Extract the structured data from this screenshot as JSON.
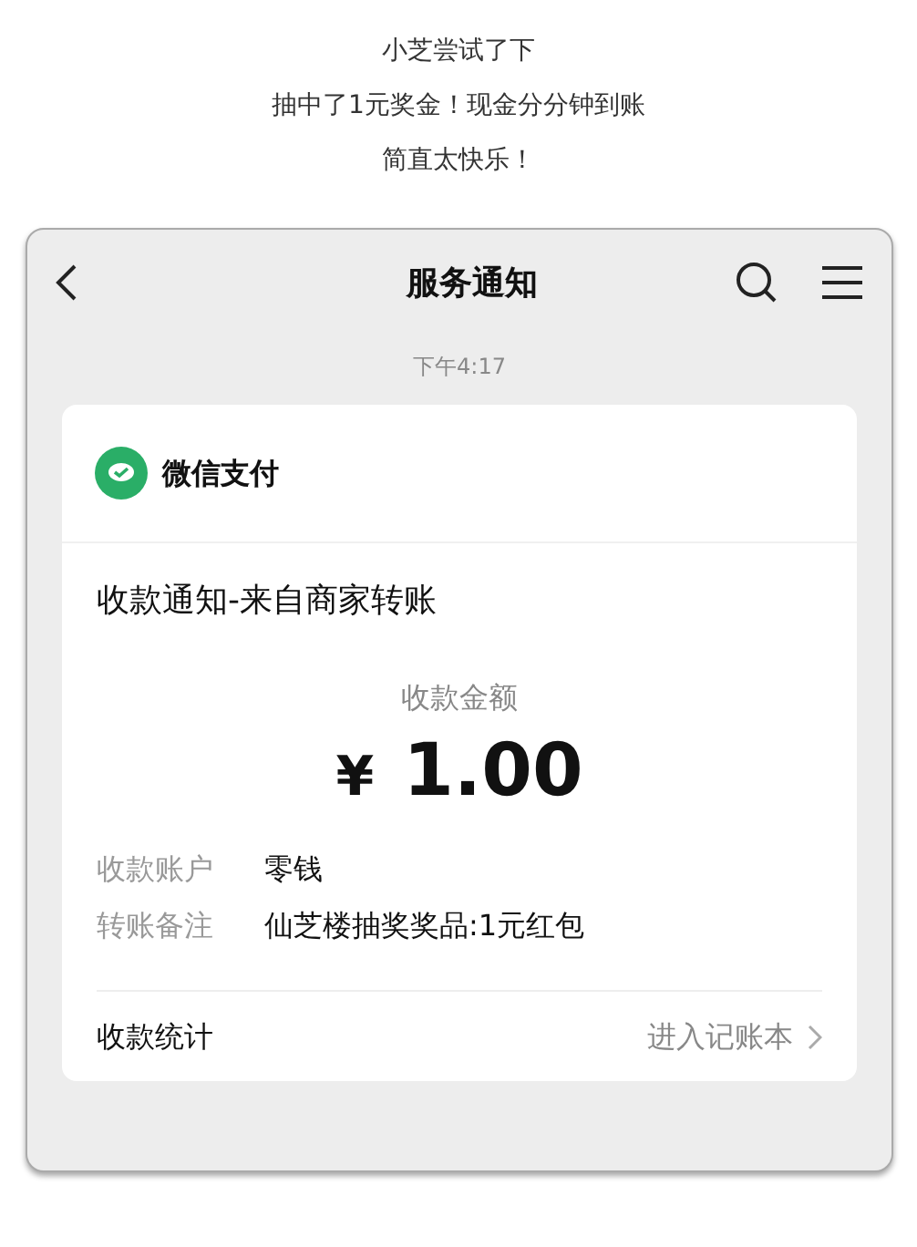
{
  "caption": [
    "小芝尝试了下",
    "抽中了1元奖金！现金分分钟到账",
    "简直太快乐！"
  ],
  "header": {
    "title": "服务通知"
  },
  "timestamp": "下午4:17",
  "card": {
    "sender": "微信支付",
    "title": "收款通知-来自商家转账",
    "amount_label": "收款金额",
    "currency": "¥",
    "amount": "1.00",
    "details": [
      {
        "label": "收款账户",
        "value": "零钱"
      },
      {
        "label": "转账备注",
        "value": "仙芝楼抽奖奖品:1元红包"
      }
    ],
    "footer": {
      "label": "收款统计",
      "link": "进入记账本"
    }
  }
}
